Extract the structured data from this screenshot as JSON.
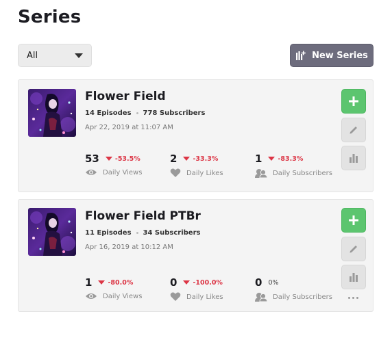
{
  "page": {
    "title": "Series"
  },
  "filter": {
    "selected": "All"
  },
  "new_series": {
    "label": "New Series"
  },
  "colors": {
    "accent_green": "#5cc56f",
    "decrease_red": "#dc3545",
    "button_gray": "#6d6c7d"
  },
  "series": [
    {
      "title": "Flower Field",
      "episodes": "14 Episodes",
      "subscribers": "778 Subscribers",
      "date": "Apr 22, 2019 at 11:07 AM",
      "stats": [
        {
          "value": "53",
          "change": "-53.5%",
          "label": "Daily Views",
          "icon": "eye-icon"
        },
        {
          "value": "2",
          "change": "-33.3%",
          "label": "Daily Likes",
          "icon": "heart-icon"
        },
        {
          "value": "1",
          "change": "-83.3%",
          "label": "Daily Subscribers",
          "icon": "users-icon"
        }
      ]
    },
    {
      "title": "Flower Field PTBr",
      "episodes": "11 Episodes",
      "subscribers": "34 Subscribers",
      "date": "Apr 16, 2019 at 10:12 AM",
      "stats": [
        {
          "value": "1",
          "change": "-80.0%",
          "label": "Daily Views",
          "icon": "eye-icon"
        },
        {
          "value": "0",
          "change": "-100.0%",
          "label": "Daily Likes",
          "icon": "heart-icon"
        },
        {
          "value": "0",
          "change": "0%",
          "label": "Daily Subscribers",
          "icon": "users-icon"
        }
      ]
    }
  ]
}
